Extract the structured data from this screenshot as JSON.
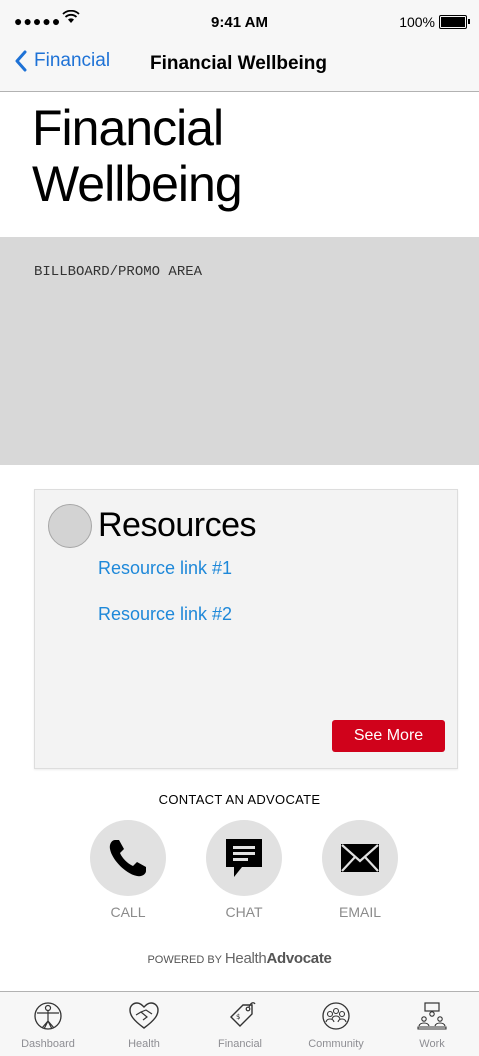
{
  "status_bar": {
    "signal": "●●●●●",
    "time": "9:41 AM",
    "battery": "100%"
  },
  "nav_bar": {
    "back_label": "Financial",
    "title": "Financial Wellbeing"
  },
  "hero": {
    "title_line1": "Financial",
    "title_line2": "Wellbeing"
  },
  "billboard": {
    "label": "BILLBOARD/PROMO AREA"
  },
  "resources": {
    "title": "Resources",
    "links": [
      "Resource link #1",
      "Resource link #2"
    ],
    "see_more": "See More",
    "button_color": "#d0021b",
    "link_color": "#1e88d9"
  },
  "contact": {
    "heading": "CONTACT AN ADVOCATE",
    "buttons": [
      {
        "label": "CALL",
        "icon": "phone-icon"
      },
      {
        "label": "CHAT",
        "icon": "chat-icon"
      },
      {
        "label": "EMAIL",
        "icon": "envelope-icon"
      }
    ]
  },
  "powered_by": {
    "prefix": "POWERED BY",
    "brand_light": "Health",
    "brand_bold": "Advocate"
  },
  "tab_bar": {
    "tabs": [
      {
        "label": "Dashboard",
        "icon": "vitruvian-man-icon"
      },
      {
        "label": "Health",
        "icon": "heart-handshake-icon"
      },
      {
        "label": "Financial",
        "icon": "price-tag-icon"
      },
      {
        "label": "Community",
        "icon": "people-circle-icon"
      },
      {
        "label": "Work",
        "icon": "meeting-table-icon"
      }
    ]
  }
}
